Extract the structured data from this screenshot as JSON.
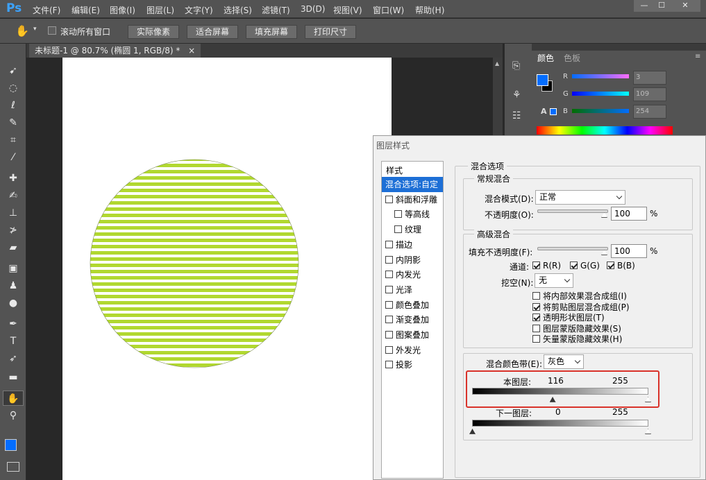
{
  "app": {
    "logo": "Ps"
  },
  "menu": [
    "文件(F)",
    "编辑(E)",
    "图像(I)",
    "图层(L)",
    "文字(Y)",
    "选择(S)",
    "滤镜(T)",
    "3D(D)",
    "视图(V)",
    "窗口(W)",
    "帮助(H)"
  ],
  "window_controls": {
    "minimize": "—",
    "maximize": "☐",
    "close": "✕"
  },
  "options": {
    "scroll_all": "滚动所有窗口",
    "buttons": [
      "实际像素",
      "适合屏幕",
      "填充屏幕",
      "打印尺寸"
    ]
  },
  "document": {
    "tab_title": "未标题-1 @ 80.7% (椭圆 1, RGB/8) *",
    "close": "×"
  },
  "color_panel": {
    "tabs": [
      "颜色",
      "色板"
    ],
    "channels": [
      {
        "label": "R",
        "value": "3"
      },
      {
        "label": "G",
        "value": "109"
      },
      {
        "label": "B",
        "value": "254"
      }
    ],
    "foreground": "#036dfe"
  },
  "dialog": {
    "title": "图层样式",
    "style_header": "样式",
    "styles": [
      {
        "label": "混合选项:自定",
        "checkbox": false,
        "selected": true,
        "indent": false
      },
      {
        "label": "斜面和浮雕",
        "checkbox": true,
        "indent": false
      },
      {
        "label": "等高线",
        "checkbox": true,
        "indent": true
      },
      {
        "label": "纹理",
        "checkbox": true,
        "indent": true
      },
      {
        "label": "描边",
        "checkbox": true,
        "indent": false
      },
      {
        "label": "内阴影",
        "checkbox": true,
        "indent": false
      },
      {
        "label": "内发光",
        "checkbox": true,
        "indent": false
      },
      {
        "label": "光泽",
        "checkbox": true,
        "indent": false
      },
      {
        "label": "颜色叠加",
        "checkbox": true,
        "indent": false
      },
      {
        "label": "渐变叠加",
        "checkbox": true,
        "indent": false
      },
      {
        "label": "图案叠加",
        "checkbox": true,
        "indent": false
      },
      {
        "label": "外发光",
        "checkbox": true,
        "indent": false
      },
      {
        "label": "投影",
        "checkbox": true,
        "indent": false
      }
    ],
    "blend_options_title": "混合选项",
    "general_blend_title": "常规混合",
    "blend_mode_label": "混合模式(D):",
    "blend_mode_value": "正常",
    "opacity_label": "不透明度(O):",
    "opacity_value": "100",
    "percent": "%",
    "advanced_title": "高级混合",
    "fill_opacity_label": "填充不透明度(F):",
    "fill_opacity_value": "100",
    "channels_label": "通道:",
    "channel_r": "R(R)",
    "channel_g": "G(G)",
    "channel_b": "B(B)",
    "knockout_label": "挖空(N):",
    "knockout_value": "无",
    "options": [
      {
        "label": "将内部效果混合成组(I)",
        "checked": false
      },
      {
        "label": "将剪贴图层混合成组(P)",
        "checked": true
      },
      {
        "label": "透明形状图层(T)",
        "checked": true
      },
      {
        "label": "图层蒙版隐藏效果(S)",
        "checked": false
      },
      {
        "label": "矢量蒙版隐藏效果(H)",
        "checked": false
      }
    ],
    "blend_if_label": "混合颜色带(E):",
    "blend_if_value": "灰色",
    "this_layer_label": "本图层:",
    "this_layer_low": "116",
    "this_layer_high": "255",
    "underlying_label": "下一图层:",
    "underlying_low": "0",
    "underlying_high": "255",
    "this_layer_low_fraction": 0.455,
    "underlying_low_fraction": 0.0
  }
}
